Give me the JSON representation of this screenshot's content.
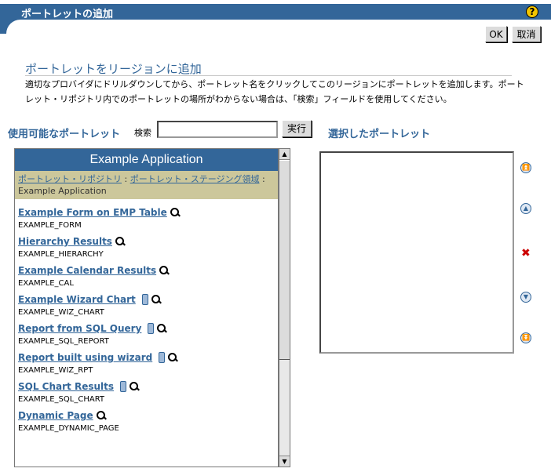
{
  "header": {
    "title": "ポートレットの追加",
    "help_icon": "help-icon"
  },
  "buttons": {
    "ok": "OK",
    "cancel": "取消",
    "execute": "実行"
  },
  "section": {
    "title": "ポートレットをリージョンに追加",
    "instructions": "適切なプロバイダにドリルダウンしてから、ポートレット名をクリックしてこのリージョンにポートレットを追加します。ポートレット・リポジトリ内でのポートレットの場所がわからない場合は、「検索」フィールドを使用してください。"
  },
  "available": {
    "label": "使用可能なポートレット",
    "search_label": "検索",
    "search_value": "",
    "panel_title": "Example Application",
    "breadcrumb": {
      "link1": "ポートレット・リポジトリ",
      "sep": " : ",
      "link2": "ポートレット・ステージング領域",
      "current": "Example Application"
    },
    "items": [
      {
        "title": "Example Form on EMP Table",
        "id": "EXAMPLE_FORM",
        "mobile": false
      },
      {
        "title": "Hierarchy Results",
        "id": "EXAMPLE_HIERARCHY",
        "mobile": false
      },
      {
        "title": "Example Calendar Results",
        "id": "EXAMPLE_CAL",
        "mobile": false
      },
      {
        "title": "Example Wizard Chart",
        "id": "EXAMPLE_WIZ_CHART",
        "mobile": true
      },
      {
        "title": "Report from SQL Query",
        "id": "EXAMPLE_SQL_REPORT",
        "mobile": true
      },
      {
        "title": "Report built using wizard",
        "id": "EXAMPLE_WIZ_RPT",
        "mobile": true
      },
      {
        "title": "SQL Chart Results",
        "id": "EXAMPLE_SQL_CHART",
        "mobile": true
      },
      {
        "title": "Dynamic Page",
        "id": "EXAMPLE_DYNAMIC_PAGE",
        "mobile": false
      }
    ]
  },
  "selected": {
    "label": "選択したポートレット"
  },
  "controls": [
    "move-top-icon",
    "move-up-icon",
    "delete-icon",
    "move-down-icon",
    "move-bottom-icon"
  ],
  "colors": {
    "header_bg": "#336699",
    "breadcrumb_bg": "#ccc79b",
    "link": "#336699"
  }
}
